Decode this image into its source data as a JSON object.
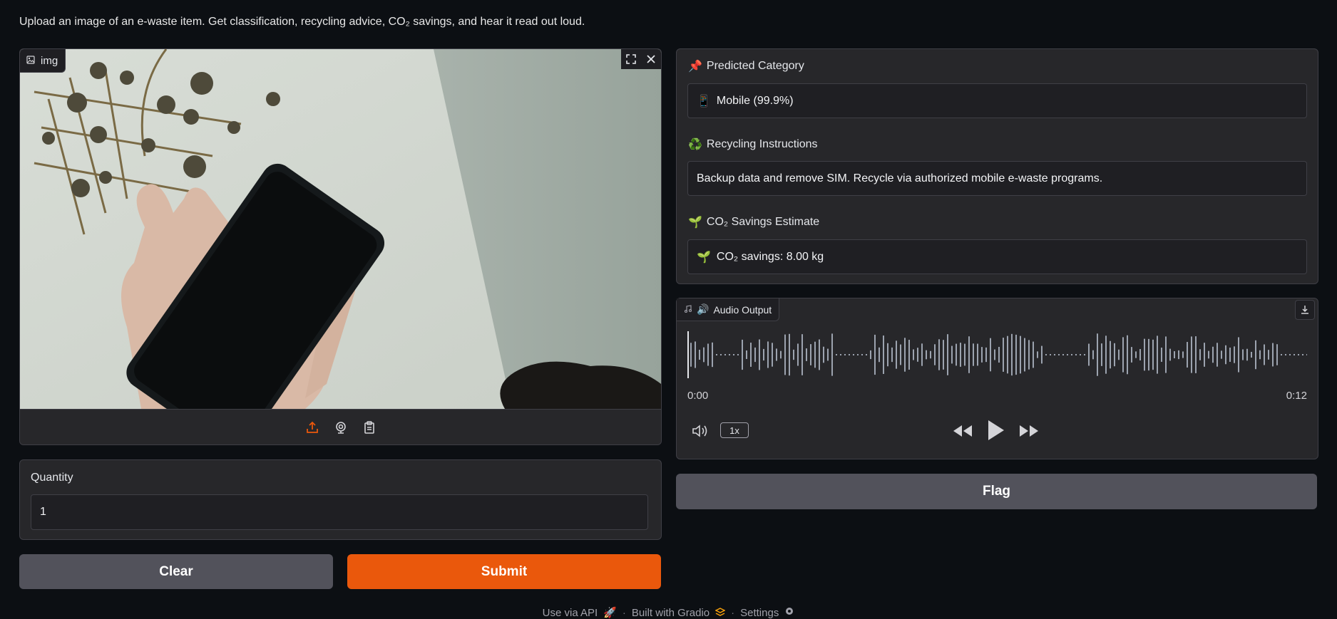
{
  "description": "Upload an image of an e-waste item. Get classification, recycling advice, CO₂ savings, and hear it read out loud.",
  "image_input": {
    "label": "img",
    "icons": [
      "image-icon",
      "fullscreen-icon",
      "close-icon",
      "upload-icon",
      "webcam-icon",
      "clipboard-icon"
    ]
  },
  "quantity": {
    "label": "Quantity",
    "value": "1"
  },
  "buttons": {
    "clear": "Clear",
    "submit": "Submit",
    "flag": "Flag"
  },
  "outputs": {
    "category": {
      "emoji": "📌",
      "label": "Predicted Category",
      "value_emoji": "📱",
      "value": "Mobile (99.9%)"
    },
    "recycling": {
      "emoji": "♻️",
      "label": "Recycling Instructions",
      "value": "Backup data and remove SIM. Recycle via authorized mobile e-waste programs."
    },
    "co2": {
      "emoji": "🌱",
      "label": "CO₂ Savings Estimate",
      "value_emoji": "🌱",
      "value": "CO₂ savings: 8.00 kg"
    }
  },
  "audio": {
    "emoji": "🔊",
    "label": "Audio Output",
    "current_time": "0:00",
    "duration": "0:12",
    "playback_rate": "1x"
  },
  "footer": {
    "api": "Use via API",
    "api_emoji": "🚀",
    "built": "Built with Gradio",
    "settings": "Settings"
  },
  "colors": {
    "accent": "#ea580c",
    "panel": "#27272a",
    "background": "#0c0f13"
  }
}
